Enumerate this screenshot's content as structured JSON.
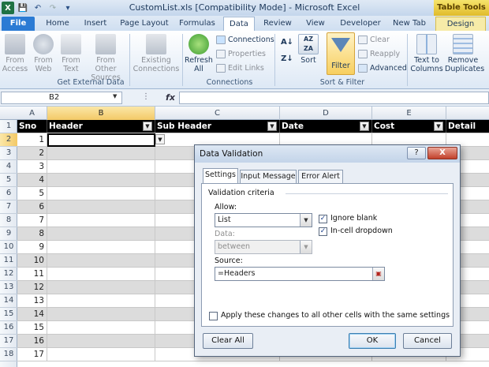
{
  "window": {
    "title": "CustomList.xls  [Compatibility Mode]  -  Microsoft Excel",
    "contextual_tab_group": "Table Tools"
  },
  "ribbon_tabs": [
    "File",
    "Home",
    "Insert",
    "Page Layout",
    "Formulas",
    "Data",
    "Review",
    "View",
    "Developer",
    "New Tab",
    "Design"
  ],
  "active_tab": "Data",
  "ribbon": {
    "get_external": {
      "label": "Get External Data",
      "buttons": [
        "From Access",
        "From Web",
        "From Text",
        "From Other Sources"
      ]
    },
    "existing_connections": "Existing Connections",
    "connections_group": {
      "label": "Connections",
      "refresh": "Refresh All",
      "connections": "Connections",
      "properties": "Properties",
      "edit_links": "Edit Links"
    },
    "sort_filter": {
      "label": "Sort & Filter",
      "sort": "Sort",
      "filter": "Filter",
      "clear": "Clear",
      "reapply": "Reapply",
      "advanced": "Advanced"
    },
    "data_tools": {
      "text_to_columns": "Text to Columns",
      "remove_duplicates": "Remove Duplicates"
    }
  },
  "formula_bar": {
    "name_box": "B2",
    "fx": "fx",
    "formula": ""
  },
  "sheet": {
    "columns": [
      "A",
      "B",
      "C",
      "D",
      "E"
    ],
    "selected_column": "B",
    "selected_row": "2",
    "row_numbers": [
      "1",
      "2",
      "3",
      "4",
      "5",
      "6",
      "7",
      "8",
      "9",
      "10",
      "11",
      "12",
      "13",
      "14",
      "15",
      "16",
      "17",
      "18"
    ],
    "headers": [
      "Sno",
      "Header",
      "Sub Header",
      "Date",
      "Cost",
      "Detail"
    ],
    "sno": [
      "1",
      "2",
      "3",
      "4",
      "5",
      "6",
      "7",
      "8",
      "9",
      "10",
      "11",
      "12",
      "13",
      "14",
      "15",
      "16",
      "17"
    ]
  },
  "dialog": {
    "title": "Data Validation",
    "help": "?",
    "close": "X",
    "tabs": [
      "Settings",
      "Input Message",
      "Error Alert"
    ],
    "active_tab": "Settings",
    "section_label": "Validation criteria",
    "allow_label": "Allow:",
    "allow_value": "List",
    "ignore_blank_label": "Ignore blank",
    "ignore_blank_checked": true,
    "in_cell_dropdown_label": "In-cell dropdown",
    "in_cell_dropdown_checked": true,
    "data_label": "Data:",
    "data_value": "between",
    "source_label": "Source:",
    "source_value": "=Headers",
    "apply_all_label": "Apply these changes to all other cells with the same settings",
    "apply_all_checked": false,
    "clear_all": "Clear All",
    "ok": "OK",
    "cancel": "Cancel"
  }
}
